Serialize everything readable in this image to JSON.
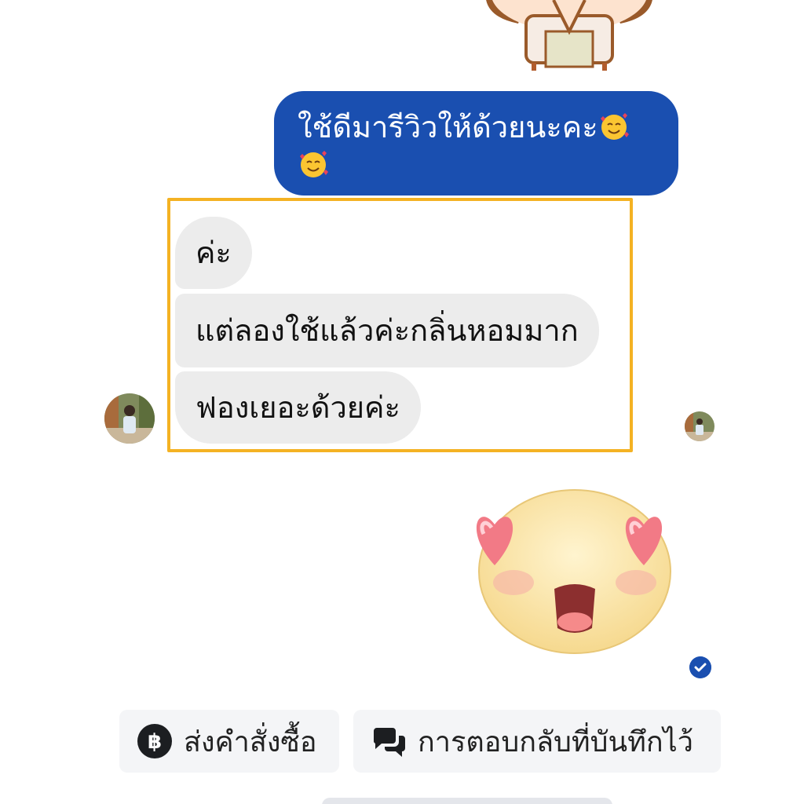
{
  "thread": {
    "outgoing_message": "ใช้ดีมารีวิวให้ด้วยนะคะ",
    "incoming_messages": [
      {
        "text": "ค่ะ"
      },
      {
        "text": "แต่ลองใช้แล้วค่ะกลิ่นหอมมาก"
      },
      {
        "text": "ฟองเยอะด้วยค่ะ"
      }
    ],
    "highlight_color": "#f4b223",
    "outgoing_bubble_color": "#1a4fb0",
    "incoming_bubble_color": "#ececec",
    "sent_status_icon": "check-circle-icon"
  },
  "quick_replies": {
    "send_order_label": "ส่งคำสั่งซื้อ",
    "send_order_icon": "baht-icon",
    "saved_replies_label": "การตอบกลับที่บันทึกไว้",
    "saved_replies_icon": "chat-bubbles-icon"
  }
}
